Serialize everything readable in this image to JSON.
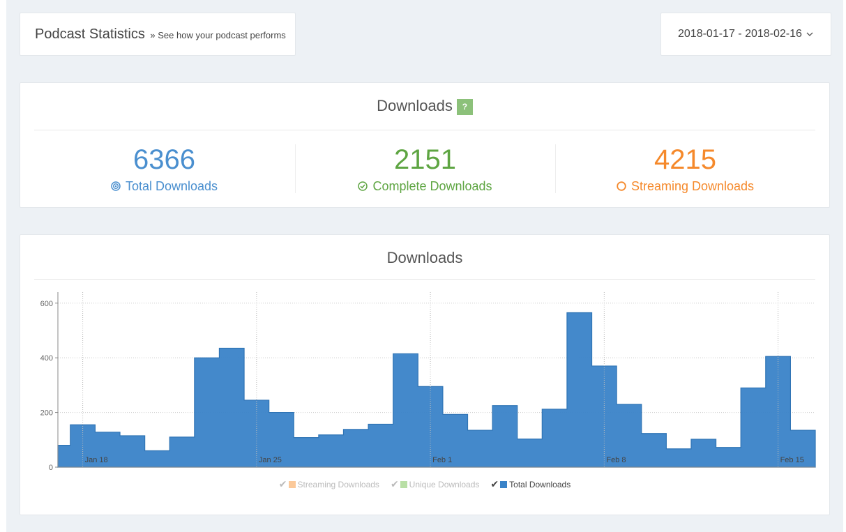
{
  "header": {
    "title": "Podcast Statistics",
    "subtitle": "» See how your podcast performs"
  },
  "date_range": {
    "label": "2018-01-17 - 2018-02-16",
    "icon": "chevron-down-icon"
  },
  "stats": {
    "title": "Downloads",
    "help": "?",
    "total": {
      "value": "6366",
      "label": "Total Downloads",
      "color": "#4a8fcf",
      "icon": "bullseye-icon"
    },
    "complete": {
      "value": "2151",
      "label": "Complete Downloads",
      "color": "#5ea542",
      "icon": "check-circle-icon"
    },
    "streaming": {
      "value": "4215",
      "label": "Streaming Downloads",
      "color": "#f5892b",
      "icon": "circle-icon"
    }
  },
  "chart_panel": {
    "title": "Downloads"
  },
  "chart_data": {
    "type": "area",
    "x": [
      "2018-01-17",
      "2018-01-18",
      "2018-01-19",
      "2018-01-20",
      "2018-01-21",
      "2018-01-22",
      "2018-01-23",
      "2018-01-24",
      "2018-01-25",
      "2018-01-26",
      "2018-01-27",
      "2018-01-28",
      "2018-01-29",
      "2018-01-30",
      "2018-01-31",
      "2018-02-01",
      "2018-02-02",
      "2018-02-03",
      "2018-02-04",
      "2018-02-05",
      "2018-02-06",
      "2018-02-07",
      "2018-02-08",
      "2018-02-09",
      "2018-02-10",
      "2018-02-11",
      "2018-02-12",
      "2018-02-13",
      "2018-02-14",
      "2018-02-15",
      "2018-02-16"
    ],
    "x_tick_labels": [
      {
        "x": "2018-01-18",
        "label": "Jan 18"
      },
      {
        "x": "2018-01-25",
        "label": "Jan 25"
      },
      {
        "x": "2018-02-01",
        "label": "Feb 1"
      },
      {
        "x": "2018-02-08",
        "label": "Feb 8"
      },
      {
        "x": "2018-02-15",
        "label": "Feb 15"
      }
    ],
    "series": [
      {
        "name": "Total Downloads",
        "color": "#3a83c8",
        "visible": true,
        "values": [
          80,
          155,
          128,
          115,
          60,
          110,
          400,
          435,
          245,
          200,
          108,
          118,
          138,
          157,
          415,
          295,
          193,
          135,
          225,
          103,
          212,
          565,
          370,
          230,
          123,
          67,
          102,
          72,
          290,
          405,
          135
        ]
      }
    ],
    "legend": [
      {
        "name": "Streaming Downloads",
        "color": "#fbc99a",
        "visible": false
      },
      {
        "name": "Unique Downloads",
        "color": "#b9dfa6",
        "visible": false
      },
      {
        "name": "Total Downloads",
        "color": "#3a83c8",
        "visible": true
      }
    ],
    "yticks": [
      0,
      200,
      400,
      600
    ],
    "ylim": [
      0,
      630
    ],
    "grid": true,
    "legend_position": "bottom-center"
  }
}
